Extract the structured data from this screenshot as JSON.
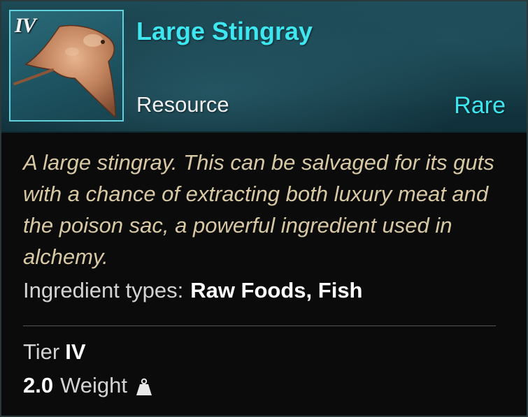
{
  "item": {
    "tier_badge": "IV",
    "name": "Large Stingray",
    "category": "Resource",
    "rarity": "Rare",
    "description": "A large stingray. This can be salvaged for its guts with a chance of extracting both luxury meat and the poison sac, a powerful ingredient used in alchemy.",
    "ingredient_types_label": "Ingredient types:",
    "ingredient_types_value": "Raw Foods, Fish",
    "tier_label": "Tier",
    "tier_value": "IV",
    "weight_value": "2.0",
    "weight_label": "Weight",
    "icon": "stingray-icon",
    "weight_icon": "weight-icon"
  },
  "colors": {
    "rarity_accent": "#3ee6f0",
    "description_text": "#d8c9a4",
    "header_bg": "#1d4a55"
  }
}
